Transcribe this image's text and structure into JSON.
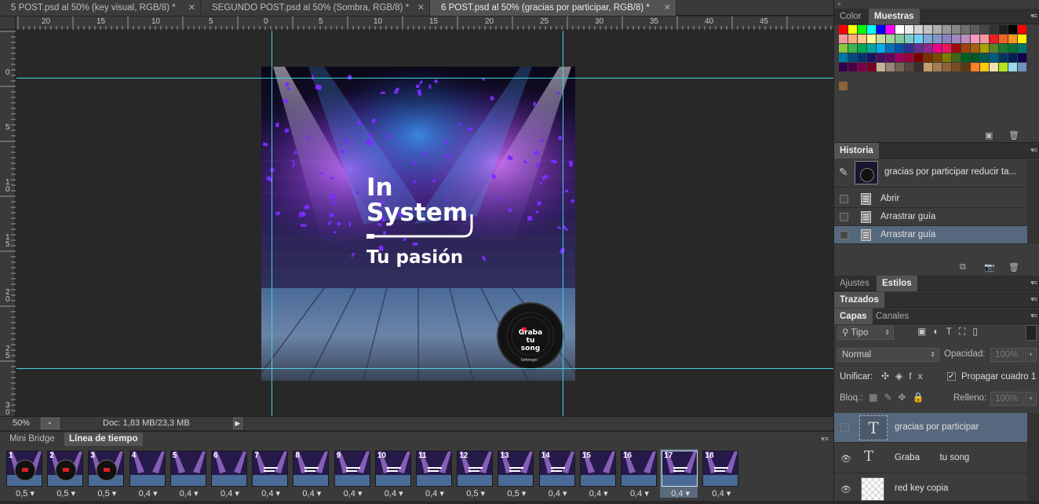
{
  "tabs": [
    {
      "label": "5 POST.psd al 50% (key visual, RGB/8) *",
      "active": false
    },
    {
      "label": "SEGUNDO POST.psd al 50% (Sombra, RGB/8) *",
      "active": false
    },
    {
      "label": "6 POST.psd al 50% (gracias por participar, RGB/8) *",
      "active": true
    }
  ],
  "ruler_top_labels": [
    "20",
    "15",
    "10",
    "5",
    "0",
    "5",
    "10",
    "15",
    "20",
    "25",
    "30",
    "35",
    "40",
    "45"
  ],
  "ruler_left_labels": [
    "0",
    "5",
    "1\n0",
    "1\n5",
    "2\n0",
    "2\n5",
    "3\n0"
  ],
  "artwork": {
    "title_line1": "In",
    "title_line2": "System",
    "subtitle": "Tu pasión",
    "badge_line1": "Graba",
    "badge_line2": "tu song",
    "badge_brand": "behringer"
  },
  "status": {
    "zoom": "50%",
    "doc_info": "Doc: 1,83 MB/23,3 MB"
  },
  "timeline": {
    "tabs": [
      "Mini Bridge",
      "Línea de tiempo"
    ],
    "active_tab": "Línea de tiempo",
    "selected_frame": 17,
    "frames": [
      {
        "num": "1",
        "delay": "0,5",
        "variant": "badge"
      },
      {
        "num": "2",
        "delay": "0,5",
        "variant": "badge"
      },
      {
        "num": "3",
        "delay": "0,5",
        "variant": "badge"
      },
      {
        "num": "4",
        "delay": "0,4",
        "variant": "stage"
      },
      {
        "num": "5",
        "delay": "0,4",
        "variant": "stage"
      },
      {
        "num": "6",
        "delay": "0,4",
        "variant": "stage"
      },
      {
        "num": "7",
        "delay": "0,4",
        "variant": "text"
      },
      {
        "num": "8",
        "delay": "0,4",
        "variant": "text"
      },
      {
        "num": "9",
        "delay": "0,4",
        "variant": "text"
      },
      {
        "num": "10",
        "delay": "0,4",
        "variant": "text"
      },
      {
        "num": "11",
        "delay": "0,4",
        "variant": "text"
      },
      {
        "num": "12",
        "delay": "0,5",
        "variant": "text"
      },
      {
        "num": "13",
        "delay": "0,5",
        "variant": "text"
      },
      {
        "num": "14",
        "delay": "0,4",
        "variant": "text"
      },
      {
        "num": "15",
        "delay": "0,4",
        "variant": "stage"
      },
      {
        "num": "16",
        "delay": "0,4",
        "variant": "stage"
      },
      {
        "num": "17",
        "delay": "0,4",
        "variant": "text"
      },
      {
        "num": "18",
        "delay": "0,4",
        "variant": "text"
      }
    ]
  },
  "swatches_panel": {
    "tabs": [
      "Color",
      "Muestras"
    ],
    "active_tab": "Muestras"
  },
  "history_panel": {
    "title": "Historia",
    "snapshot_label": "gracias por participar reducir ta...",
    "items": [
      {
        "label": "Abrir",
        "selected": false
      },
      {
        "label": "Arrastrar guía",
        "selected": false
      },
      {
        "label": "Arrastrar guía",
        "selected": true
      }
    ]
  },
  "adjust_panel": {
    "tabs": [
      "Ajustes",
      "Estilos"
    ],
    "active_tab": "Estilos"
  },
  "paths_panel": {
    "title": "Trazados"
  },
  "layers_panel": {
    "tabs": [
      "Capas",
      "Canales"
    ],
    "active_tab": "Capas",
    "filter_kind": "Tipo",
    "blend_mode": "Normal",
    "opacity_label": "Opacidad:",
    "opacity_value": "100%",
    "unify_label": "Unificar:",
    "propagate_label": "Propagar cuadro 1",
    "lock_label": "Bloq.:",
    "fill_label": "Relleno:",
    "fill_value": "100%",
    "layers": [
      {
        "name": "gracias por participar",
        "type": "text",
        "visible": false,
        "selected": true
      },
      {
        "name": "Graba        tu song",
        "type": "text",
        "visible": true,
        "selected": false
      },
      {
        "name": "red key copia",
        "type": "raster",
        "visible": true,
        "selected": false
      }
    ]
  },
  "colors": {
    "guide": "#46d2e0",
    "selection": "#55687e",
    "accent_purple": "#7a2cff"
  }
}
